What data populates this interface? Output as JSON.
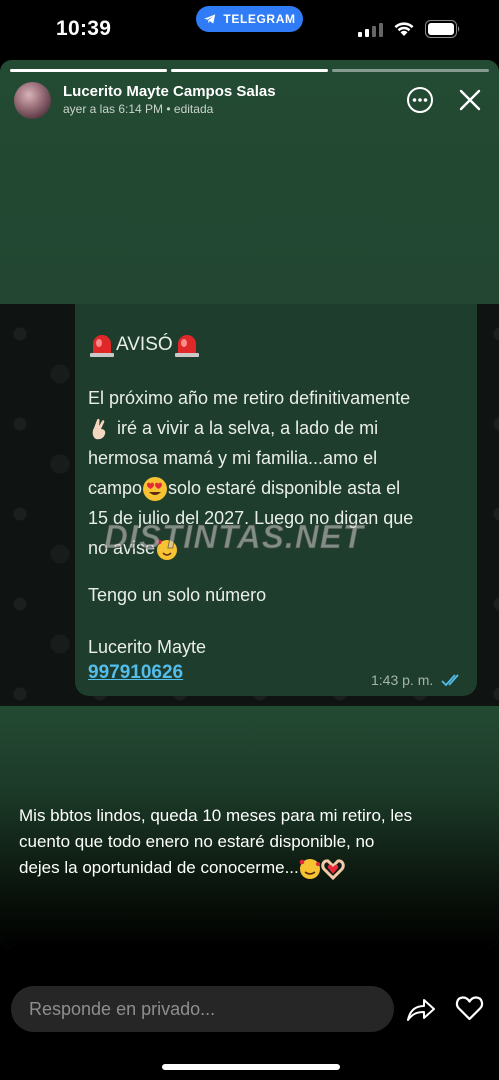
{
  "status_bar": {
    "time": "10:39",
    "pill_label": "TELEGRAM",
    "pill_icon": "telegram-plane-icon"
  },
  "story": {
    "author": "Lucerito Mayte Campos Salas",
    "meta": "ayer a las 6:14 PM • editada",
    "progress_segments": 3,
    "active_segment": 2,
    "icons": {
      "more": "more-options-icon",
      "close": "close-icon"
    }
  },
  "message": {
    "heading": "AVISÓ",
    "paragraph_lines": [
      "El próximo año me retiro definitivamente",
      "iré a vivir a la selva, a lado de mi",
      "hermosa mamá y mi familia...amo el",
      "solo estaré disponible asta el",
      "15 de julio del 2027. Luego no digan que",
      "no avise"
    ],
    "campo_word": "campo",
    "single_line": "Tengo un solo número",
    "signature": "Lucerito Mayte",
    "phone": "997910626",
    "time": "1:43 p. m.",
    "watermark": "DISTINTAS.NET"
  },
  "caption": {
    "lines": [
      "Mis bbtos lindos, queda 10 meses para mi retiro, les",
      "cuento que todo enero no estaré disponible,  no",
      "dejes la oportunidad de conocerme..."
    ]
  },
  "reply": {
    "placeholder": "Responde en privado..."
  },
  "colors": {
    "story_bg": "#224631",
    "bubble_bg": "#1f3d2c",
    "link": "#53bdeb",
    "pill": "#2f7cf6"
  }
}
